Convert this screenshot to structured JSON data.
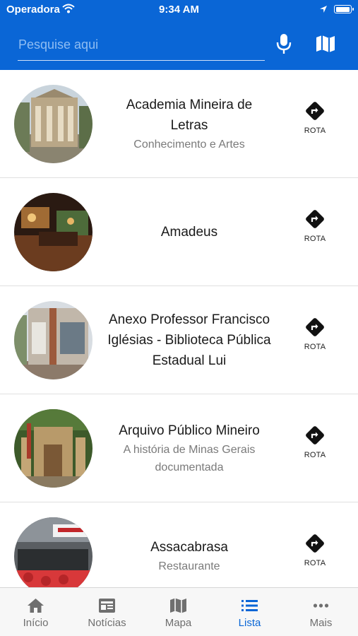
{
  "status_bar": {
    "carrier": "Operadora",
    "time": "9:34 AM"
  },
  "search": {
    "placeholder": "Pesquise aqui"
  },
  "list": {
    "items": [
      {
        "title": "Academia Mineira de Letras",
        "subtitle": "Conhecimento e Artes",
        "action": "ROTA"
      },
      {
        "title": "Amadeus",
        "subtitle": "",
        "action": "ROTA"
      },
      {
        "title": "Anexo Professor Francisco Iglésias - Biblioteca Pública Estadual Lui",
        "subtitle": "",
        "action": "ROTA"
      },
      {
        "title": "Arquivo Público Mineiro",
        "subtitle": "A história de Minas Gerais documentada",
        "action": "ROTA"
      },
      {
        "title": "Assacabrasa",
        "subtitle": "Restaurante",
        "action": "ROTA"
      }
    ]
  },
  "tabs": [
    {
      "label": "Início",
      "icon": "home-icon",
      "active": false
    },
    {
      "label": "Notícias",
      "icon": "newspaper-icon",
      "active": false
    },
    {
      "label": "Mapa",
      "icon": "map-icon",
      "active": false
    },
    {
      "label": "Lista",
      "icon": "list-icon",
      "active": true
    },
    {
      "label": "Mais",
      "icon": "more-icon",
      "active": false
    }
  ],
  "colors": {
    "brand": "#0a66d6",
    "active_tab": "#0a66d6",
    "inactive_tab": "#6f6f6f"
  }
}
